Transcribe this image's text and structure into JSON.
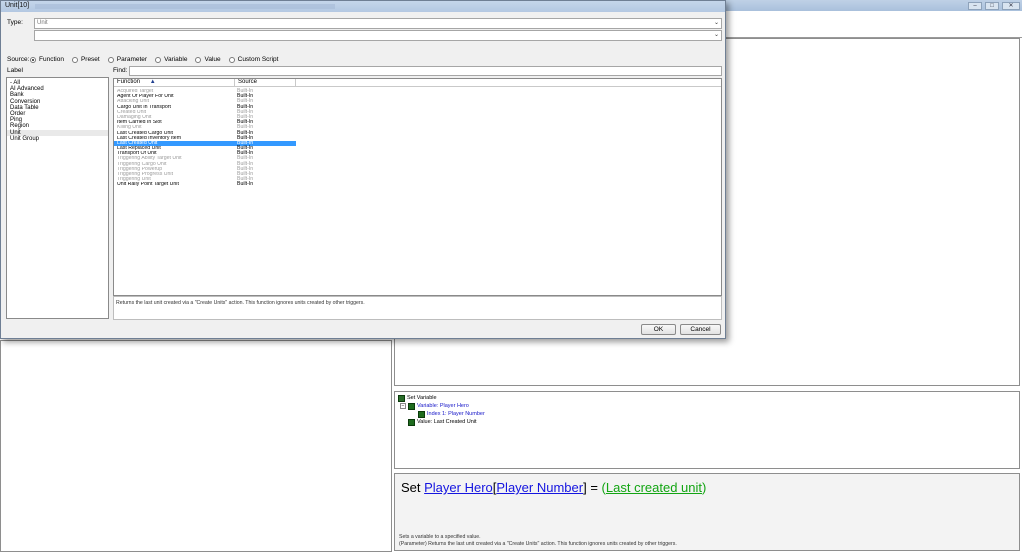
{
  "app": {
    "window_controls": [
      "–",
      "□",
      "✕"
    ]
  },
  "dialog": {
    "title": "Unit[10]",
    "type_label": "Type:",
    "type_value": "Unit",
    "source_label": "Source:",
    "source_options": [
      {
        "label": "Function",
        "selected": true
      },
      {
        "label": "Preset",
        "selected": false
      },
      {
        "label": "Parameter",
        "selected": false
      },
      {
        "label": "Variable",
        "selected": false
      },
      {
        "label": "Value",
        "selected": false
      },
      {
        "label": "Custom Script",
        "selected": false
      }
    ],
    "label_header": "Label",
    "find_label": "Find:",
    "find_value": "",
    "labels": [
      "- All",
      "AI Advanced",
      "Bank",
      "Conversion",
      "Data Table",
      "Order",
      "Ping",
      "Region",
      "Unit",
      "Unit Group"
    ],
    "selected_label": "Unit",
    "columns": {
      "function": "Function",
      "source": "Source"
    },
    "sort_indicator": "▲",
    "functions": [
      {
        "name": "Acquired Target",
        "source": "Built-In",
        "enabled": false
      },
      {
        "name": "Agent Of Player For Unit",
        "source": "Built-In",
        "enabled": true
      },
      {
        "name": "Attacking Unit",
        "source": "Built-In",
        "enabled": false
      },
      {
        "name": "Cargo Unit In Transport",
        "source": "Built-In",
        "enabled": true
      },
      {
        "name": "Created Unit",
        "source": "Built-In",
        "enabled": false
      },
      {
        "name": "Damaging Unit",
        "source": "Built-In",
        "enabled": false
      },
      {
        "name": "Item Carried In Slot",
        "source": "Built-In",
        "enabled": true
      },
      {
        "name": "Killing Unit",
        "source": "Built-In",
        "enabled": false
      },
      {
        "name": "Last Created Cargo Unit",
        "source": "Built-In",
        "enabled": true
      },
      {
        "name": "Last Created Inventory Item",
        "source": "Built-In",
        "enabled": true
      },
      {
        "name": "Last Created Unit",
        "source": "Built-In",
        "enabled": true,
        "selected": true
      },
      {
        "name": "Last Replaced Unit",
        "source": "Built-In",
        "enabled": true
      },
      {
        "name": "Transport Of Unit",
        "source": "Built-In",
        "enabled": true
      },
      {
        "name": "Triggering Ability Target Unit",
        "source": "Built-In",
        "enabled": false
      },
      {
        "name": "Triggering Cargo Unit",
        "source": "Built-In",
        "enabled": false
      },
      {
        "name": "Triggering Powerup",
        "source": "Built-In",
        "enabled": false
      },
      {
        "name": "Triggering Progress Unit",
        "source": "Built-In",
        "enabled": false
      },
      {
        "name": "Triggering Unit",
        "source": "Built-In",
        "enabled": false
      },
      {
        "name": "Unit Rally Point Target Unit",
        "source": "Built-In",
        "enabled": true
      }
    ],
    "description": "Returns the last unit created via a \"Create Units\" action.  This function ignores units created by other triggers.",
    "ok_label": "OK",
    "cancel_label": "Cancel"
  },
  "tree": {
    "root": "Set Variable",
    "variable": "Variable: Player Hero",
    "index": "Index 1: Player Number",
    "value": "Value: Last Created Unit"
  },
  "sentence": {
    "prefix": "Set ",
    "variable": "Player Hero",
    "bracket_open": "[",
    "index": "Player Number",
    "bracket_close": "]",
    "equals": " = ",
    "paren_open": "(",
    "value": "Last created unit",
    "paren_close": ")",
    "desc_line1": "Sets a variable to a specified value.",
    "desc_line2": "(Parameter) Returns the last unit created via a \"Create Units\" action.  This function ignores units created by other triggers."
  }
}
